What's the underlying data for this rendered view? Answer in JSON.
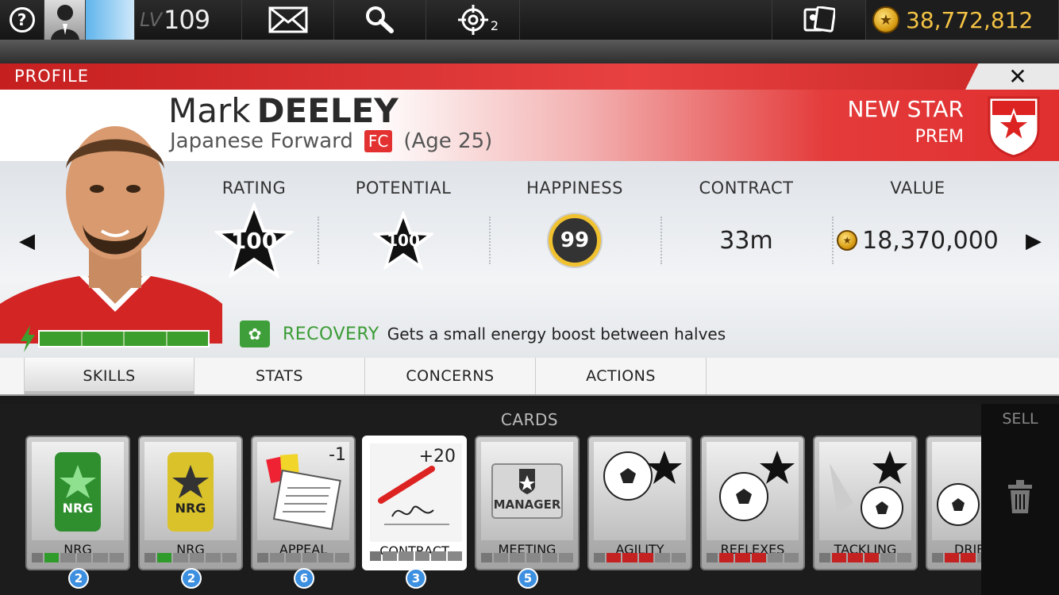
{
  "topbar": {
    "help_icon": "?",
    "level_label": "LV",
    "level": "109",
    "target_count": "2",
    "coins": "38,772,812"
  },
  "header": {
    "label": "PROFILE",
    "close_icon": "✕"
  },
  "player": {
    "first_name": "Mark",
    "last_name": "DEELEY",
    "nationality_position": "Japanese Forward",
    "team_badge": "FC",
    "age": "(Age 25)",
    "league_line1": "NEW STAR",
    "league_line2": "PREM"
  },
  "stats": {
    "rating": {
      "label": "RATING",
      "value": "100"
    },
    "potential": {
      "label": "POTENTIAL",
      "value": "100"
    },
    "happiness": {
      "label": "HAPPINESS",
      "value": "99"
    },
    "contract": {
      "label": "CONTRACT",
      "value": "33m"
    },
    "value": {
      "label": "VALUE",
      "value": "18,370,000"
    },
    "energy_level": 1.0
  },
  "trait": {
    "name": "RECOVERY",
    "description": "Gets a small energy boost between halves"
  },
  "tabs": [
    {
      "label": "SKILLS",
      "active": true
    },
    {
      "label": "STATS",
      "active": false
    },
    {
      "label": "CONCERNS",
      "active": false
    },
    {
      "label": "ACTIONS",
      "active": false
    }
  ],
  "cards_section": {
    "title": "CARDS",
    "sell_label": "SELL",
    "cards": [
      {
        "name": "NRG",
        "count": "2",
        "modifier": ""
      },
      {
        "name": "NRG",
        "count": "2",
        "modifier": ""
      },
      {
        "name": "APPEAL",
        "count": "6",
        "modifier": "-1"
      },
      {
        "name": "CONTRACT",
        "count": "3",
        "modifier": "+20"
      },
      {
        "name": "MEETING",
        "count": "5",
        "modifier": ""
      },
      {
        "name": "AGILITY",
        "count": "",
        "modifier": ""
      },
      {
        "name": "REFLEXES",
        "count": "",
        "modifier": ""
      },
      {
        "name": "TACKLING",
        "count": "",
        "modifier": ""
      },
      {
        "name": "DRIBB",
        "count": "",
        "modifier": ""
      }
    ]
  },
  "colors": {
    "accent_red": "#e33131",
    "energy_green": "#3c9e2c",
    "coin_gold": "#f4c344",
    "badge_blue": "#3d8fe0"
  }
}
